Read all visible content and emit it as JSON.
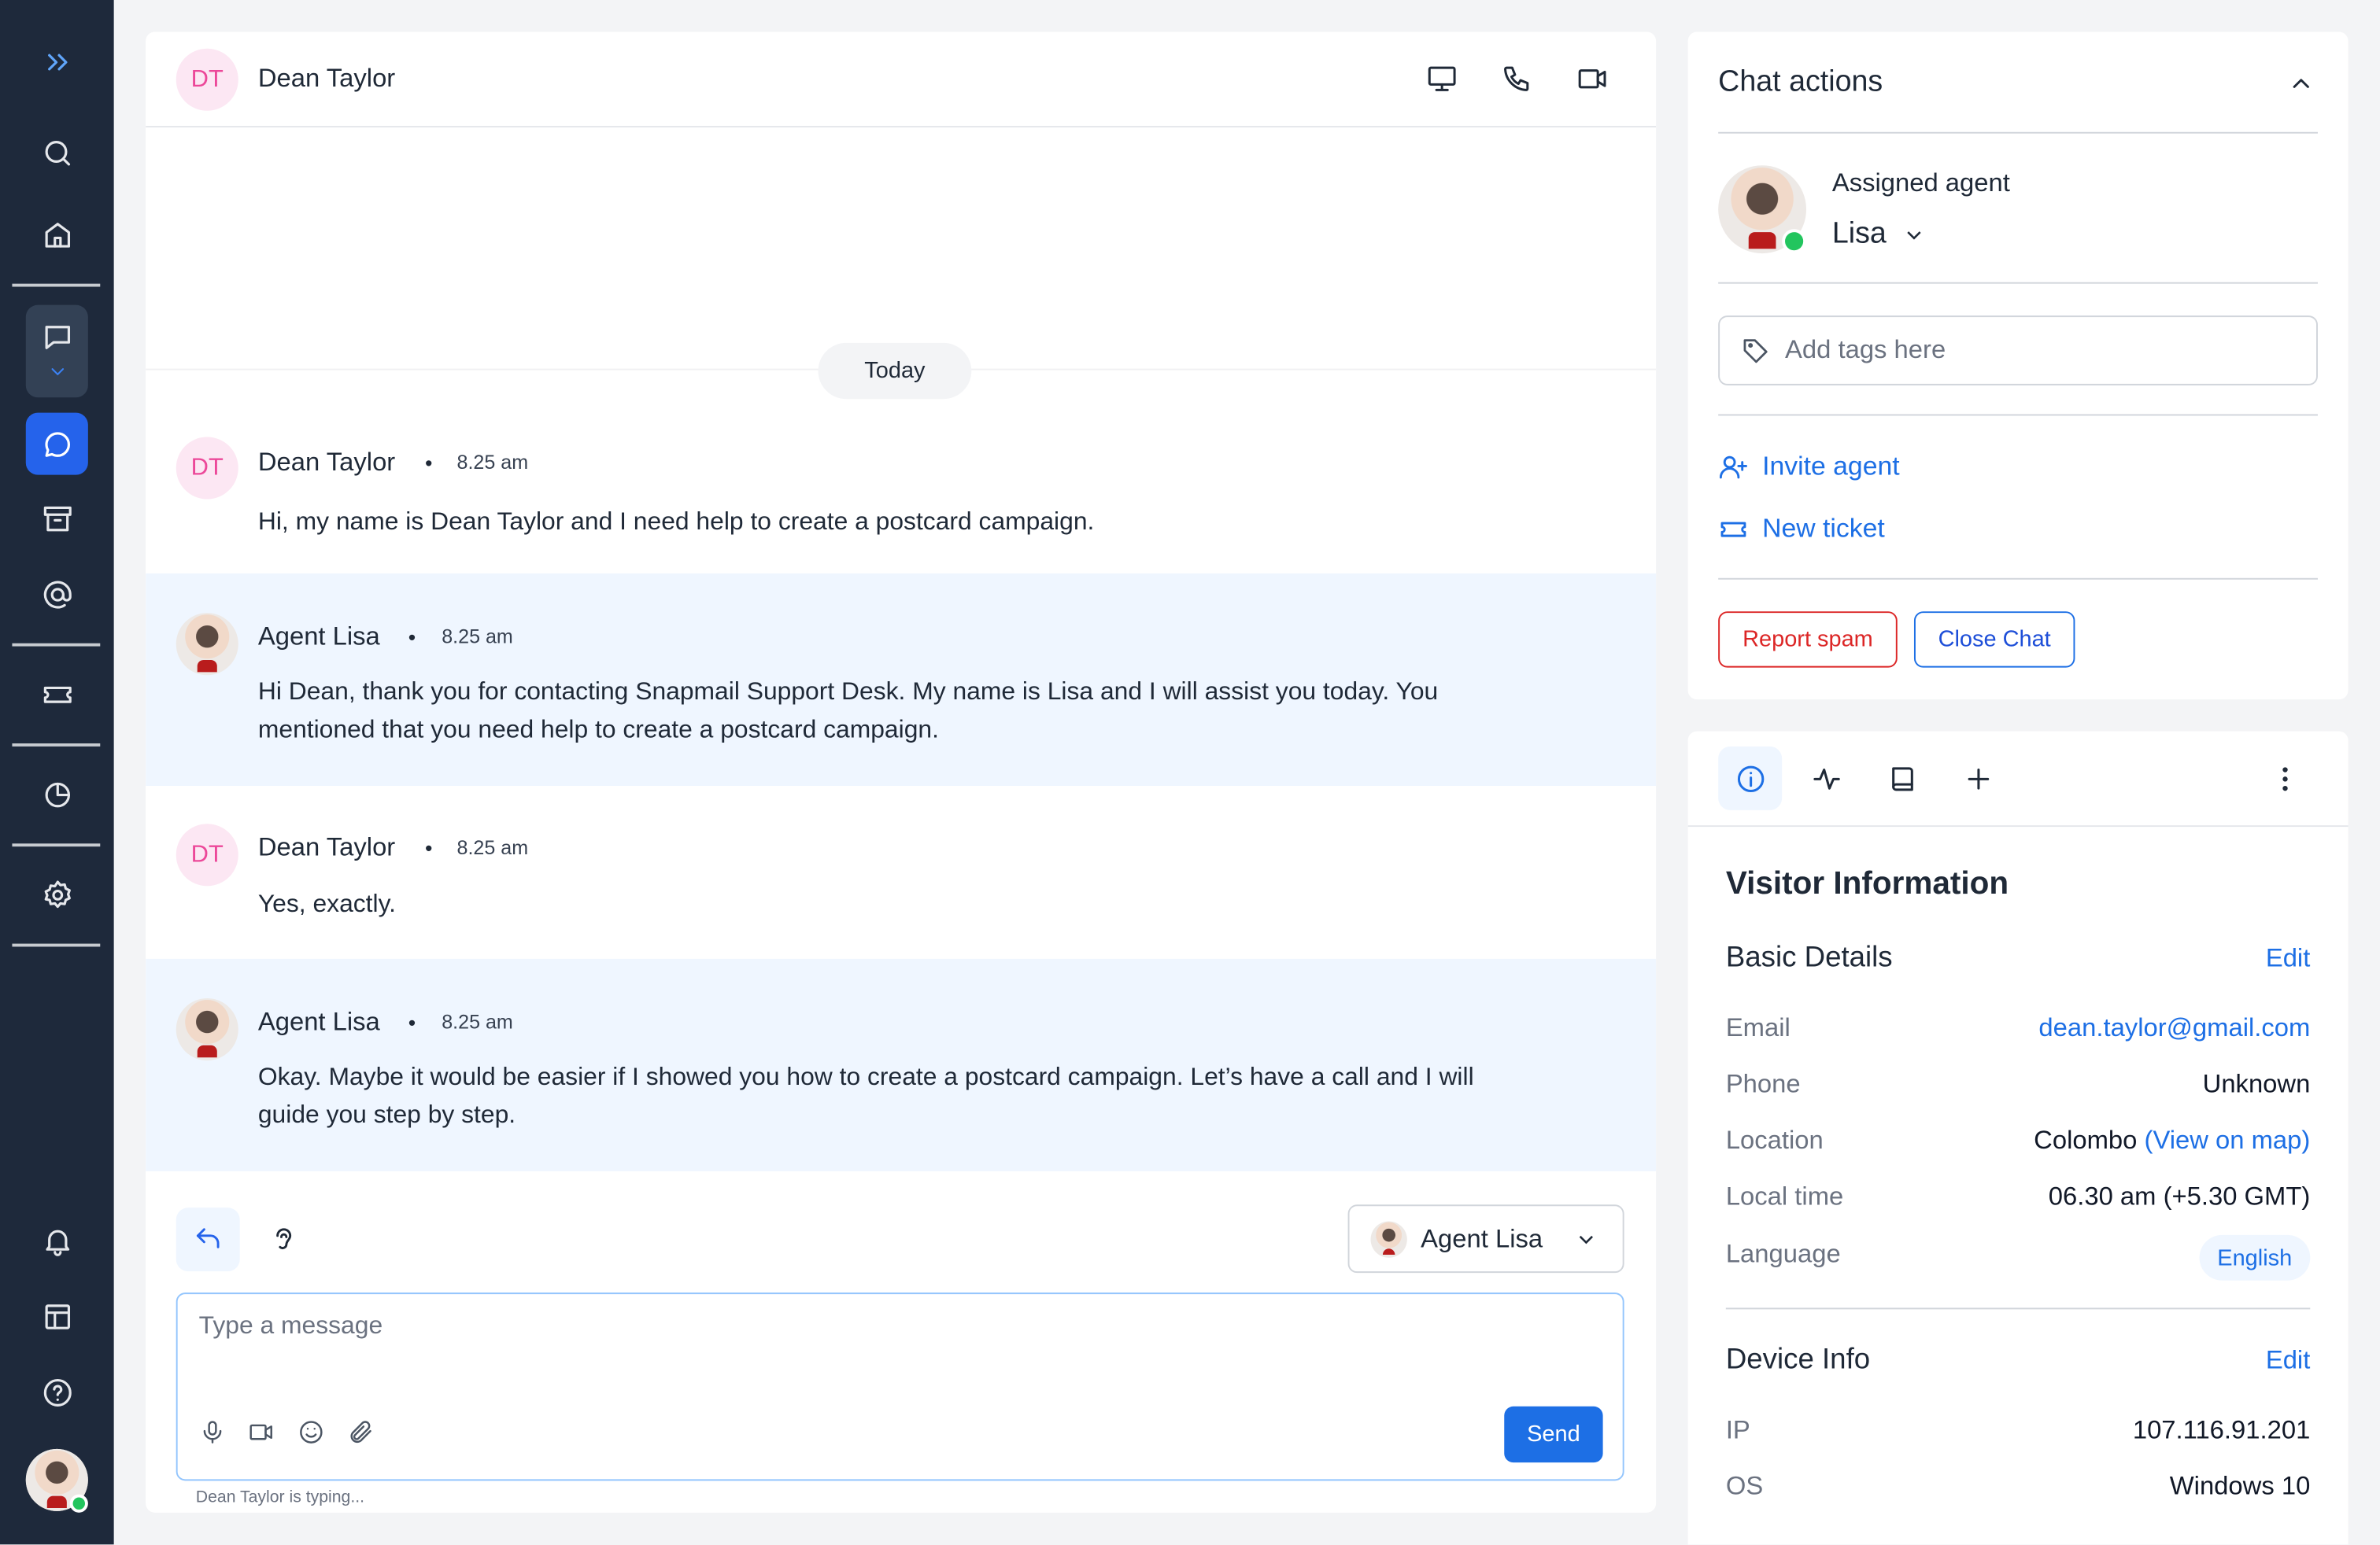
{
  "chat": {
    "contact_initials": "DT",
    "contact_name": "Dean Taylor",
    "date_divider": "Today",
    "messages": [
      {
        "initials": "DT",
        "sender": "Dean Taylor",
        "time": "8.25 am",
        "text": "Hi, my name is Dean Taylor and I need help to create a postcard campaign."
      },
      {
        "sender": "Agent Lisa",
        "time": "8.25 am",
        "text": "Hi Dean, thank you for contacting Snapmail Support Desk. My name is Lisa and I will assist you today. You mentioned that you need help to create a postcard campaign."
      },
      {
        "initials": "DT",
        "sender": "Dean Taylor",
        "time": "8.25 am",
        "text": "Yes, exactly."
      },
      {
        "sender": "Agent Lisa",
        "time": "8.25 am",
        "text": "Okay. Maybe it would be easier if I showed you how to create a postcard campaign. Let’s have a call and I will guide you step by step."
      }
    ],
    "sep": "•",
    "composer": {
      "agent_selected": "Agent Lisa",
      "placeholder": "Type a message",
      "send_label": "Send",
      "typing_status": "Dean Taylor is typing..."
    }
  },
  "actions": {
    "title": "Chat actions",
    "assigned_label": "Assigned agent",
    "assigned_name": "Lisa",
    "tags_placeholder": "Add tags here",
    "invite_label": "Invite agent",
    "ticket_label": "New ticket",
    "spam_label": "Report spam",
    "close_label": "Close Chat"
  },
  "visitor": {
    "title": "Visitor Information",
    "basic": {
      "title": "Basic Details",
      "edit": "Edit",
      "email_label": "Email",
      "email": "dean.taylor@gmail.com",
      "phone_label": "Phone",
      "phone": "Unknown",
      "location_label": "Location",
      "location": "Colombo",
      "map_link": "(View on map)",
      "time_label": "Local time",
      "time": "06.30 am (+5.30 GMT)",
      "language_label": "Language",
      "language": "English"
    },
    "device": {
      "title": "Device Info",
      "edit": "Edit",
      "ip_label": "IP",
      "ip": "107.116.91.201",
      "os_label": "OS",
      "os": "Windows 10"
    }
  },
  "colors": {
    "sidebar": "#1e293b",
    "accent": "#1d6fe5",
    "agent_msg_bg": "#eff6ff",
    "danger": "#dc2626",
    "online": "#22c55e"
  },
  "icons": {
    "sidebar": [
      "expand-icon",
      "search-icon",
      "home-icon",
      "chat-icon",
      "chat-bubble-icon",
      "archive-icon",
      "at-icon",
      "ticket-icon",
      "reports-icon",
      "settings-icon",
      "bell-icon",
      "layout-icon",
      "help-icon"
    ],
    "header": [
      "screen-share-icon",
      "phone-icon",
      "video-icon"
    ],
    "composer": [
      "reply-icon",
      "ear-icon",
      "mic-icon",
      "video-icon",
      "emoji-icon",
      "attachment-icon"
    ],
    "info_tabs": [
      "info-icon",
      "activity-icon",
      "book-icon",
      "plus-icon",
      "more-vertical-icon"
    ]
  }
}
